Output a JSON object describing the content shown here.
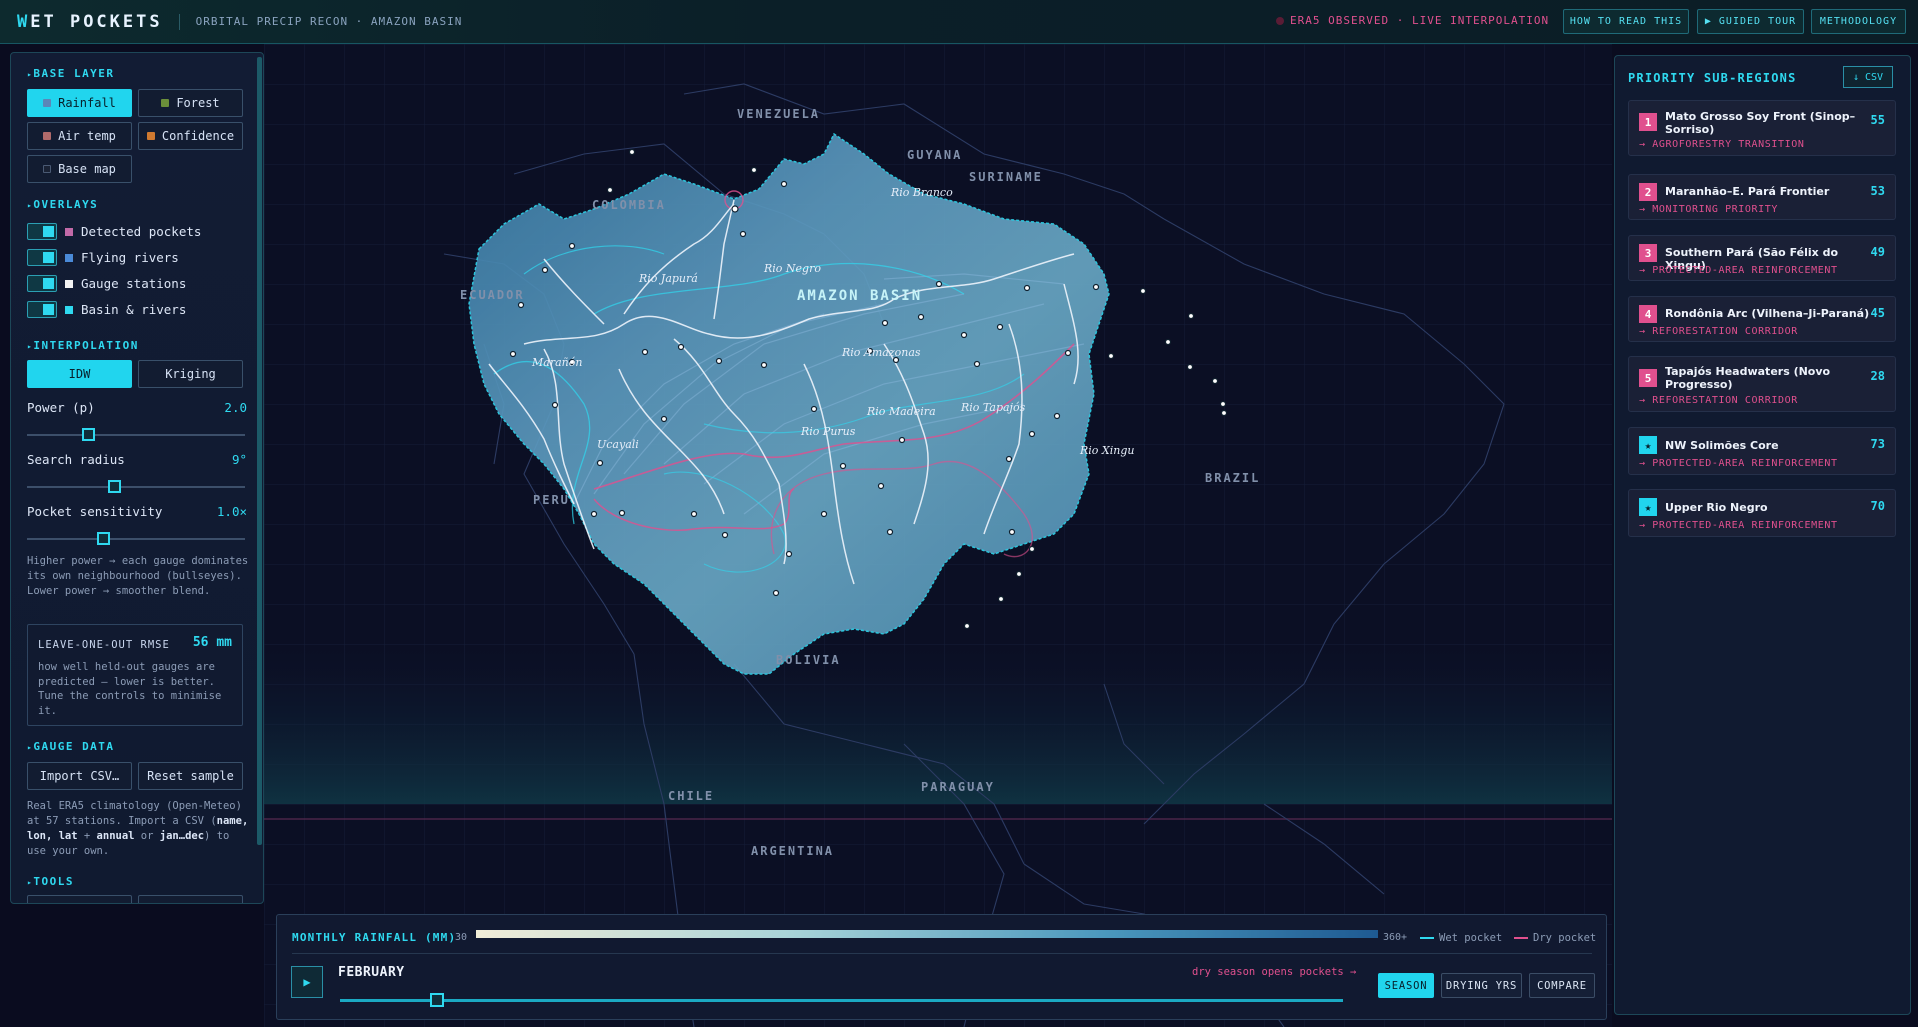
{
  "header": {
    "logo_prefix": "W",
    "logo_rest": "ET POCKETS",
    "subtitle": "ORBITAL PRECIP RECON · AMAZON BASIN",
    "status": "ERA5 OBSERVED · LIVE INTERPOLATION",
    "buttons": [
      "HOW TO READ THIS",
      "▶ GUIDED TOUR",
      "METHODOLOGY"
    ]
  },
  "left": {
    "base_layer_title": "BASE LAYER",
    "base_layers": [
      {
        "label": "Rainfall",
        "swatch": "#5b87b8",
        "active": true
      },
      {
        "label": "Forest",
        "swatch": "#6b8f3a",
        "active": false
      },
      {
        "label": "Air temp",
        "swatch": "#b06a6a",
        "active": false
      },
      {
        "label": "Confidence",
        "swatch": "#d07a30",
        "active": false
      },
      {
        "label": "Base map",
        "swatch": "#1a2234",
        "active": false
      }
    ],
    "overlays_title": "OVERLAYS",
    "overlays": [
      {
        "label": "Detected pockets",
        "swatch": "#c26aa8"
      },
      {
        "label": "Flying rivers",
        "swatch": "#4a8ad8"
      },
      {
        "label": "Gauge stations",
        "swatch": "#f2f2f2"
      },
      {
        "label": "Basin & rivers",
        "swatch": "#2fd9f0"
      }
    ],
    "interpolation_title": "INTERPOLATION",
    "methods": [
      {
        "label": "IDW",
        "active": true
      },
      {
        "label": "Kriging",
        "active": false
      }
    ],
    "params": [
      {
        "label": "Power (p)",
        "value": "2.0",
        "fraction": 0.28
      },
      {
        "label": "Search radius",
        "value": "9°",
        "fraction": 0.4
      },
      {
        "label": "Pocket sensitivity",
        "value": "1.0×",
        "fraction": 0.35
      }
    ],
    "power_note": "Higher power → each gauge dominates its own neighbourhood (bullseyes). Lower power → smoother blend.",
    "rmse": {
      "title": "LEAVE-ONE-OUT RMSE",
      "value": "56 mm",
      "description": "how well held-out gauges are predicted — lower is better. Tune the controls to minimise it."
    },
    "gauge_title": "GAUGE DATA",
    "gauge_buttons": [
      "Import CSV…",
      "Reset sample"
    ],
    "gauge_note_1": "Real ERA5 climatology (Open-Meteo) at 57 stations. Import a CSV (",
    "gauge_note_bold_1": "name, lon, lat",
    "gauge_note_2": " + ",
    "gauge_note_bold_2": "annual",
    "gauge_note_3": " or ",
    "gauge_note_bold_3": "jan…dec",
    "gauge_note_4": ") to use your own.",
    "tools_title": "TOOLS"
  },
  "map": {
    "countries": [
      "VENEZUELA",
      "GUYANA",
      "SURINAME",
      "COLOMBIA",
      "ECUADOR",
      "PERU",
      "BRAZIL",
      "BOLIVIA",
      "CHILE",
      "PARAGUAY",
      "ARGENTINA"
    ],
    "basin_label": "AMAZON BASIN",
    "rivers": [
      "Rio Branco",
      "Rio Negro",
      "Rio Japurá",
      "Marañón",
      "Rio Amazonas",
      "Rio Madeira",
      "Rio Tapajós",
      "Ucayali",
      "Rio Purus",
      "Rio Xingu"
    ]
  },
  "timeline": {
    "title": "MONTHLY RAINFALL (MM)",
    "min": "30",
    "max": "360+",
    "legend": [
      {
        "label": "Wet pocket",
        "color": "#2fd9f0"
      },
      {
        "label": "Dry pocket",
        "color": "#e0508e"
      }
    ],
    "month": "FEBRUARY",
    "hint": "dry season opens pockets →",
    "month_fraction": 0.09,
    "modes": [
      {
        "label": "SEASON",
        "active": true
      },
      {
        "label": "DRYING YRS",
        "active": false
      },
      {
        "label": "COMPARE",
        "active": false
      }
    ]
  },
  "right": {
    "title": "PRIORITY SUB-REGIONS",
    "csv_label": "↓ CSV",
    "regions": [
      {
        "rank": "1",
        "name": "Mato Grosso Soy Front (Sinop–Sorriso)",
        "score": "55",
        "tag": "→ AGROFORESTRY TRANSITION"
      },
      {
        "rank": "2",
        "name": "Maranhão–E. Pará Frontier",
        "score": "53",
        "tag": "→ MONITORING PRIORITY"
      },
      {
        "rank": "3",
        "name": "Southern Pará (São Félix do Xingu)",
        "score": "49",
        "tag": "→ PROTECTED-AREA REINFORCEMENT"
      },
      {
        "rank": "4",
        "name": "Rondônia Arc (Vilhena–Ji-Paraná)",
        "score": "45",
        "tag": "→ REFORESTATION CORRIDOR"
      },
      {
        "rank": "5",
        "name": "Tapajós Headwaters (Novo Progresso)",
        "score": "28",
        "tag": "→ REFORESTATION CORRIDOR"
      },
      {
        "rank": "★",
        "name": "NW Solimões Core",
        "score": "73",
        "tag": "→ PROTECTED-AREA REINFORCEMENT"
      },
      {
        "rank": "★",
        "name": "Upper Rio Negro",
        "score": "70",
        "tag": "→ PROTECTED-AREA REINFORCEMENT"
      }
    ]
  }
}
